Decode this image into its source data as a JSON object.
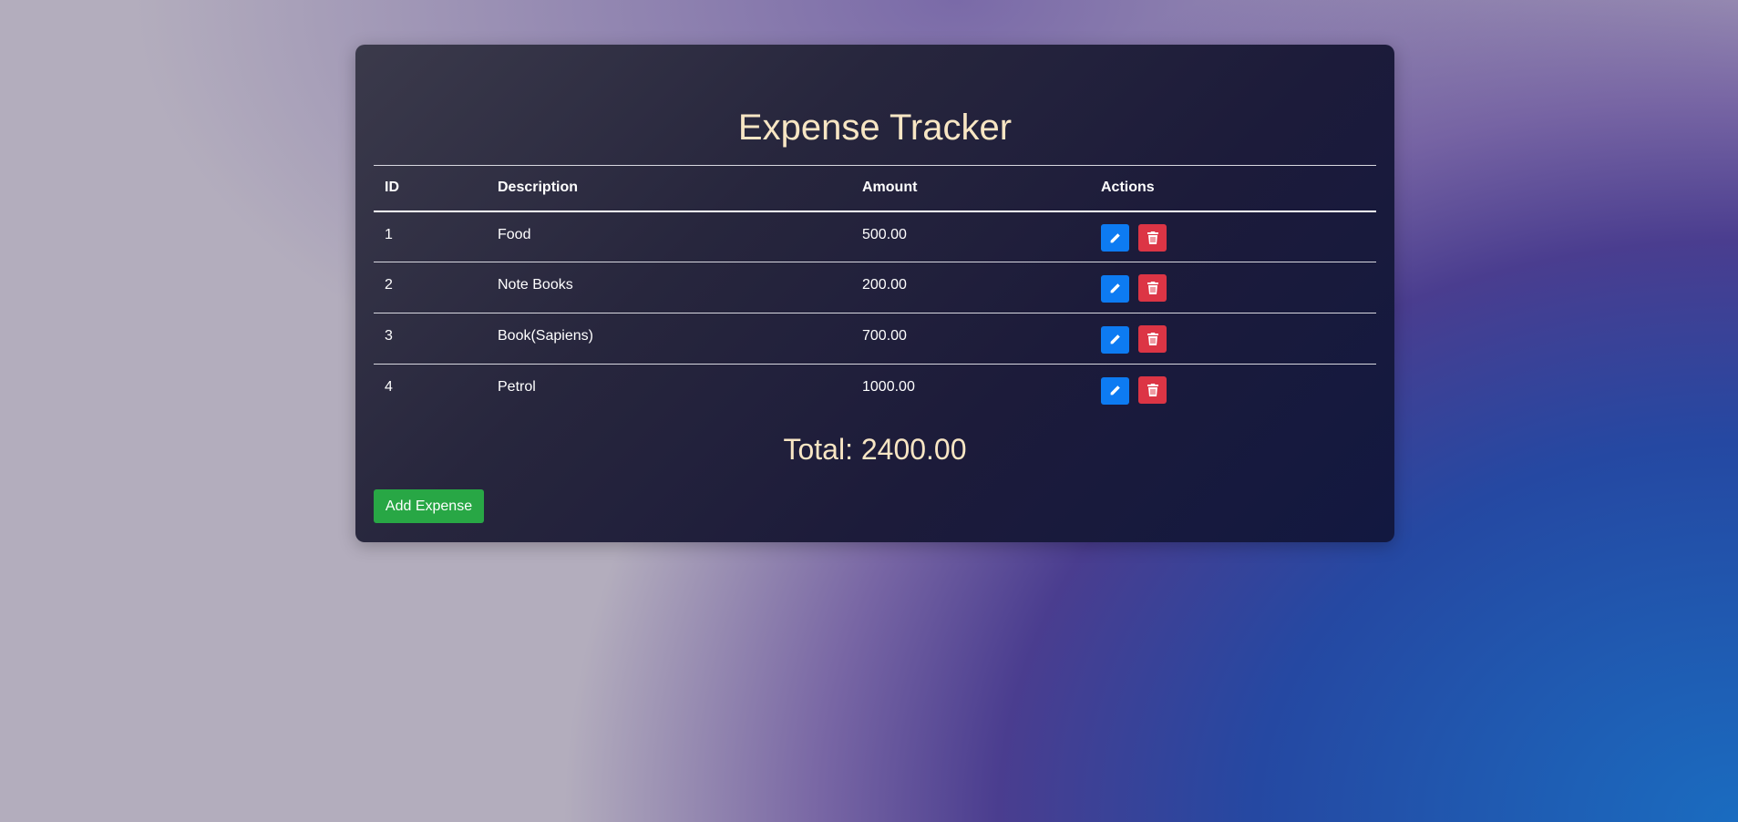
{
  "app": {
    "title": "Expense Tracker"
  },
  "table": {
    "headers": {
      "id": "ID",
      "description": "Description",
      "amount": "Amount",
      "actions": "Actions"
    },
    "rows": [
      {
        "id": "1",
        "description": "Food",
        "amount": "500.00"
      },
      {
        "id": "2",
        "description": "Note Books",
        "amount": "200.00"
      },
      {
        "id": "3",
        "description": "Book(Sapiens)",
        "amount": "700.00"
      },
      {
        "id": "4",
        "description": "Petrol",
        "amount": "1000.00"
      }
    ],
    "row_actions": {
      "edit_icon": "pencil-icon",
      "delete_icon": "trash-icon"
    }
  },
  "total": {
    "text": "Total: 2400.00"
  },
  "add_button": {
    "label": "Add Expense"
  },
  "colors": {
    "edit": "#0d7bf2",
    "delete": "#dc3545",
    "add": "#28a745",
    "title": "#f8e6c4"
  }
}
